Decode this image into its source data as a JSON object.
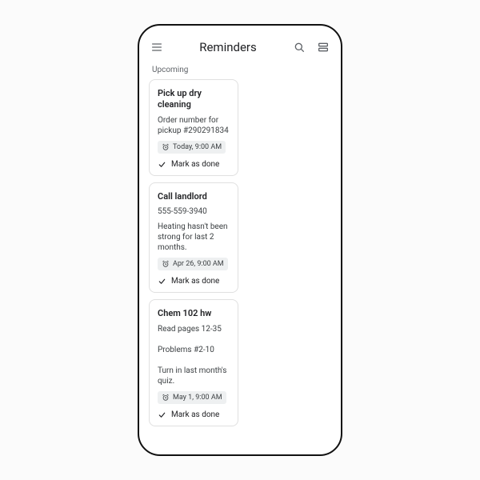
{
  "header": {
    "title": "Reminders"
  },
  "section_label": "Upcoming",
  "mark_done_label": "Mark as done",
  "cards": [
    {
      "title": "Pick up dry cleaning",
      "subtitle": "",
      "body": "Order number for pickup #290291834",
      "time": "Today, 9:00 AM"
    },
    {
      "title": "Call landlord",
      "subtitle": "555-559-3940",
      "body": "Heating hasn't been strong for last 2 months.",
      "time": "Apr 26, 9:00 AM"
    },
    {
      "title": "Chem 102 hw",
      "subtitle": "",
      "body": "Read pages 12-35\n\nProblems #2-10\n\nTurn in last month's quiz.",
      "time": "May 1, 9:00 AM"
    }
  ]
}
